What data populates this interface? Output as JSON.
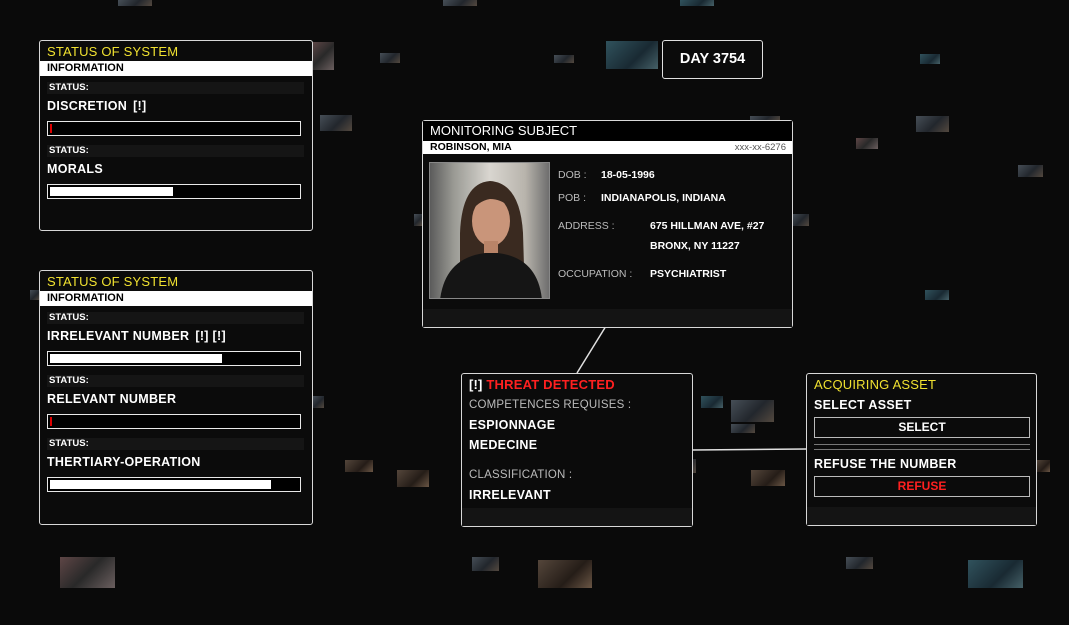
{
  "day_counter": "DAY 3754",
  "status_panel_1": {
    "title": "STATUS OF SYSTEM",
    "subtitle": "INFORMATION",
    "rows": [
      {
        "status_label": "STATUS:",
        "name": "DISCRETION",
        "flags": "[!]",
        "level": 0.01
      },
      {
        "status_label": "STATUS:",
        "name": "MORALS",
        "flags": "",
        "level": 0.5
      }
    ]
  },
  "status_panel_2": {
    "title": "STATUS OF SYSTEM",
    "subtitle": "INFORMATION",
    "rows": [
      {
        "status_label": "STATUS:",
        "name": "IRRELEVANT NUMBER",
        "flags": "[!] [!]",
        "level": 0.7
      },
      {
        "status_label": "STATUS:",
        "name": "RELEVANT NUMBER",
        "flags": "",
        "level": 0.01
      },
      {
        "status_label": "STATUS:",
        "name": "THERTIARY-OPERATION",
        "flags": "",
        "level": 0.9
      }
    ]
  },
  "monitoring": {
    "title": "MONITORING SUBJECT",
    "name": "ROBINSON, MIA",
    "ssn": "xxx-xx-6276",
    "dob_label": "DOB :",
    "dob": "18-05-1996",
    "pob_label": "POB :",
    "pob": "INDIANAPOLIS, INDIANA",
    "address_label": "ADDRESS :",
    "address_line1": "675 HILLMAN AVE, #27",
    "address_line2": "BRONX, NY 11227",
    "occupation_label": "OCCUPATION :",
    "occupation": "PSYCHIATRIST"
  },
  "threat": {
    "flag": "[!]",
    "title": "THREAT DETECTED",
    "competences_label": "COMPETENCES REQUISES :",
    "competences": [
      "ESPIONNAGE",
      "MEDECINE"
    ],
    "classification_label": "CLASSIFICATION :",
    "classification": "IRRELEVANT"
  },
  "asset": {
    "title": "ACQUIRING ASSET",
    "select_label": "SELECT ASSET",
    "select_button": "SELECT",
    "refuse_label": "REFUSE THE NUMBER",
    "refuse_button": "REFUSE"
  },
  "colors": {
    "accent_yellow": "#f0e130",
    "alert_red": "#ff2020",
    "background": "#0a0a0a",
    "border": "#d8d8d8"
  }
}
